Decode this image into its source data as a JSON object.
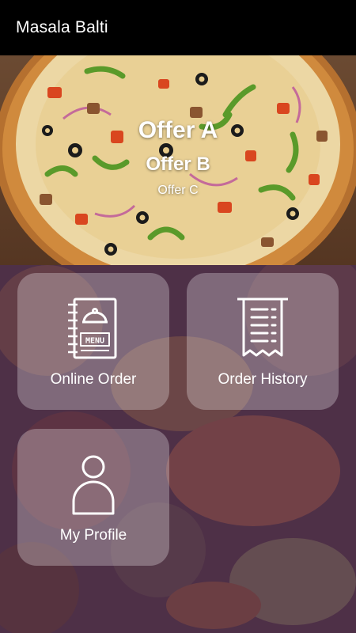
{
  "app": {
    "title": "Masala Balti"
  },
  "banner": {
    "offers": [
      "Offer A",
      "Offer B",
      "Offer C"
    ]
  },
  "menu": {
    "tiles": [
      {
        "label": "Online Order",
        "icon": "menu-book-icon"
      },
      {
        "label": "Order History",
        "icon": "receipt-icon"
      },
      {
        "label": "My Profile",
        "icon": "user-profile-icon"
      }
    ],
    "menu_icon_text": "MENU"
  },
  "colors": {
    "app_bar": "#000000",
    "tile_bg": "rgba(255,255,255,0.28)",
    "overlay": "#4a3148"
  }
}
